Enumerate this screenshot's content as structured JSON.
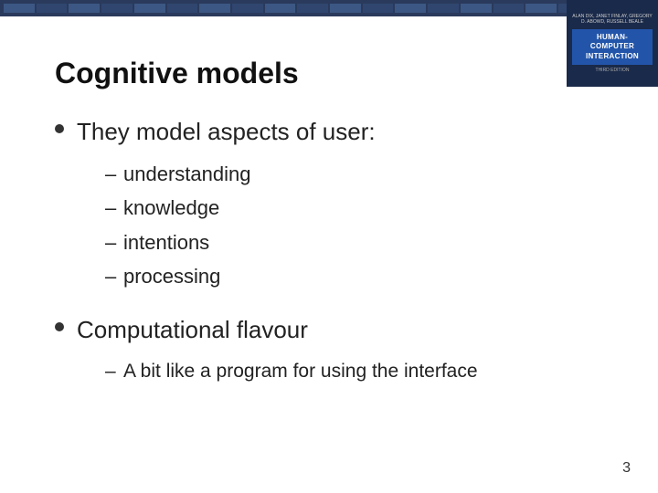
{
  "slide": {
    "title": "Cognitive models",
    "bullet1": {
      "text": "They model aspects of user:",
      "subitems": [
        "understanding",
        "knowledge",
        "intentions",
        "processing"
      ]
    },
    "bullet2": {
      "text": "Computational flavour",
      "subitems": [
        "A bit like a program for using the interface"
      ]
    },
    "slide_number": "3"
  },
  "book": {
    "authors": "ALAN DIX, JANET FINLAY,\nGREGORY D. ABOWD, RUSSELL BEALE",
    "title_line1": "HUMAN-COMPUTER",
    "title_line2": "INTERACTION",
    "edition": "THIRD EDITION"
  }
}
